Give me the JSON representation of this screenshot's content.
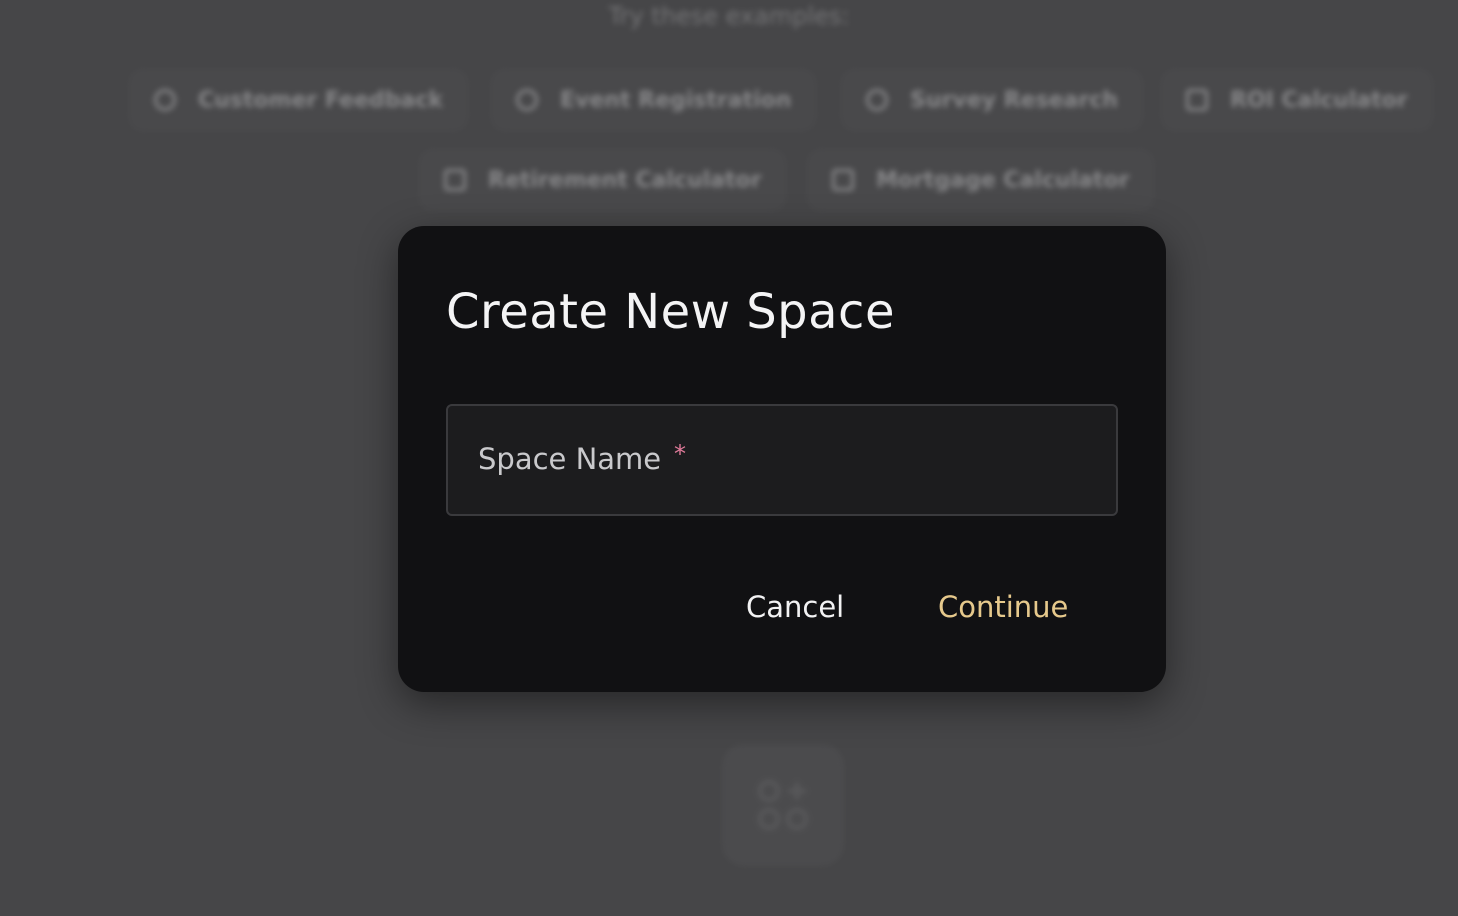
{
  "background": {
    "try_label": "Try these examples:",
    "chips_row1": [
      {
        "label": "Customer Feedback",
        "icon": "chat-bubble-icon"
      },
      {
        "label": "Event Registration",
        "icon": "chat-bubble-icon"
      },
      {
        "label": "Survey Research",
        "icon": "chat-bubble-icon"
      },
      {
        "label": "ROI Calculator",
        "icon": "calculator-icon"
      }
    ],
    "chips_row2": [
      {
        "label": "Retirement Calculator",
        "icon": "calculator-icon"
      },
      {
        "label": "Mortgage Calculator",
        "icon": "calculator-icon"
      }
    ],
    "tile_icon": "apps-add-icon"
  },
  "modal": {
    "title": "Create New Space",
    "field": {
      "label": "Space Name",
      "required_mark": "*",
      "value": ""
    },
    "cancel_label": "Cancel",
    "continue_label": "Continue"
  },
  "colors": {
    "overlay": "#464648",
    "modal_bg": "#111113",
    "field_bg": "#1c1c1e",
    "accent": "#e6c98c",
    "required": "#e07a9a"
  }
}
